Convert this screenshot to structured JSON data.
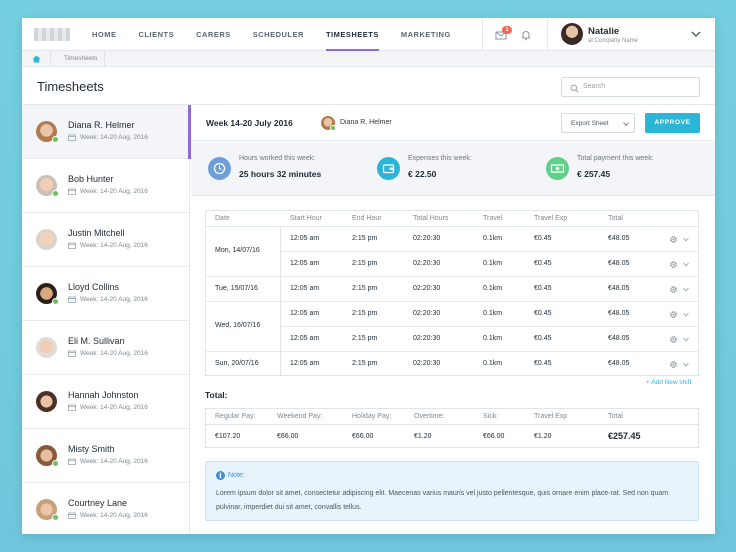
{
  "nav": {
    "items": [
      "HOME",
      "CLIENTS",
      "CARERS",
      "SCHEDULER",
      "TIMESHEETS",
      "MARKETING"
    ],
    "active": "TIMESHEETS",
    "notification_count": "1"
  },
  "user": {
    "name": "Natalie",
    "company": "at Company Name"
  },
  "breadcrumb": {
    "label": "Timesheets"
  },
  "page": {
    "title": "Timesheets",
    "search_placeholder": "Search"
  },
  "clients": [
    {
      "name": "Diana R. Helmer",
      "week": "Week: 14-20 Aug, 2016",
      "online": true,
      "active": true
    },
    {
      "name": "Bob Hunter",
      "week": "Week: 14-20 Aug, 2016",
      "online": true
    },
    {
      "name": "Justin Mitchell",
      "week": "Week: 14-20 Aug, 2016",
      "online": false
    },
    {
      "name": "Lloyd Collins",
      "week": "Week: 14-20 Aug, 2016",
      "online": true
    },
    {
      "name": "Eli M. Sullivan",
      "week": "Week: 14-20 Aug, 2016",
      "online": false
    },
    {
      "name": "Hannah Johnston",
      "week": "Week: 14-20 Aug, 2016",
      "online": false
    },
    {
      "name": "Misty Smith",
      "week": "Week: 14-20 Aug, 2016",
      "online": true
    },
    {
      "name": "Courtney Lane",
      "week": "Week: 14-20 Aug, 2016",
      "online": true
    }
  ],
  "sheet": {
    "week_label": "Week 14-20 July 2016",
    "person": "Diana R. Helmer",
    "export_label": "Export Sheet",
    "approve_label": "APPROVE"
  },
  "stats": [
    {
      "label": "Hours worked this week:",
      "value": "25 hours 32 minutes",
      "icon": "clock-icon",
      "color": "#6f9fd8"
    },
    {
      "label": "Expenses this week:",
      "value": "€ 22.50",
      "icon": "wallet-icon",
      "color": "#2bb6d6"
    },
    {
      "label": "Total payment this week:",
      "value": "€ 257.45",
      "icon": "cash-icon",
      "color": "#5fcf8a"
    }
  ],
  "table": {
    "headers": [
      "Date",
      "Start Hour",
      "End Hour",
      "Total Hours",
      "Travel",
      "Travel Exp",
      "Total"
    ],
    "groups": [
      {
        "date": "Mon, 14/07/16",
        "rows": [
          [
            "12:05 am",
            "2:15 pm",
            "02:20:30",
            "0.1km",
            "€0.45",
            "€48.05"
          ],
          [
            "12:05 am",
            "2:15 pm",
            "02:20:30",
            "0.1km",
            "€0.45",
            "€48.05"
          ]
        ]
      },
      {
        "date": "Tue, 15/07/16",
        "rows": [
          [
            "12:05 am",
            "2:15 pm",
            "02:20:30",
            "0.1km",
            "€0.45",
            "€48.05"
          ]
        ]
      },
      {
        "date": "Wed, 16/07/16",
        "rows": [
          [
            "12:05 am",
            "2:15 pm",
            "02:20:30",
            "0.1km",
            "€0.45",
            "€48.05"
          ],
          [
            "12:05 am",
            "2:15 pm",
            "02:20:30",
            "0.1km",
            "€0.45",
            "€48.05"
          ]
        ]
      },
      {
        "date": "Sun, 20/07/16",
        "rows": [
          [
            "12:05 am",
            "2:15 pm",
            "02:20:30",
            "0.1km",
            "€0.45",
            "€48.05"
          ]
        ]
      }
    ],
    "add_shift": "+ Add New shift"
  },
  "totals": {
    "label": "Total:",
    "headers": [
      "Regular Pay:",
      "Weekend Pay:",
      "Holiday Pay:",
      "Overtime:",
      "Sick:",
      "Travel Exp",
      "Total"
    ],
    "values": [
      "€107.20",
      "€66.00",
      "€66.00",
      "€1.20",
      "€66.00",
      "€1.20",
      "€257.45"
    ]
  },
  "note": {
    "title": "Note:",
    "text": "Lorem ipsum dolor sit amet, consectetur adipiscing elit. Maecenas varius mauris vel justo pellentesque, quis ornare enim place-rat. Sed non quam pulvinar, imperdiet dui sit amet, convallis tellus."
  }
}
